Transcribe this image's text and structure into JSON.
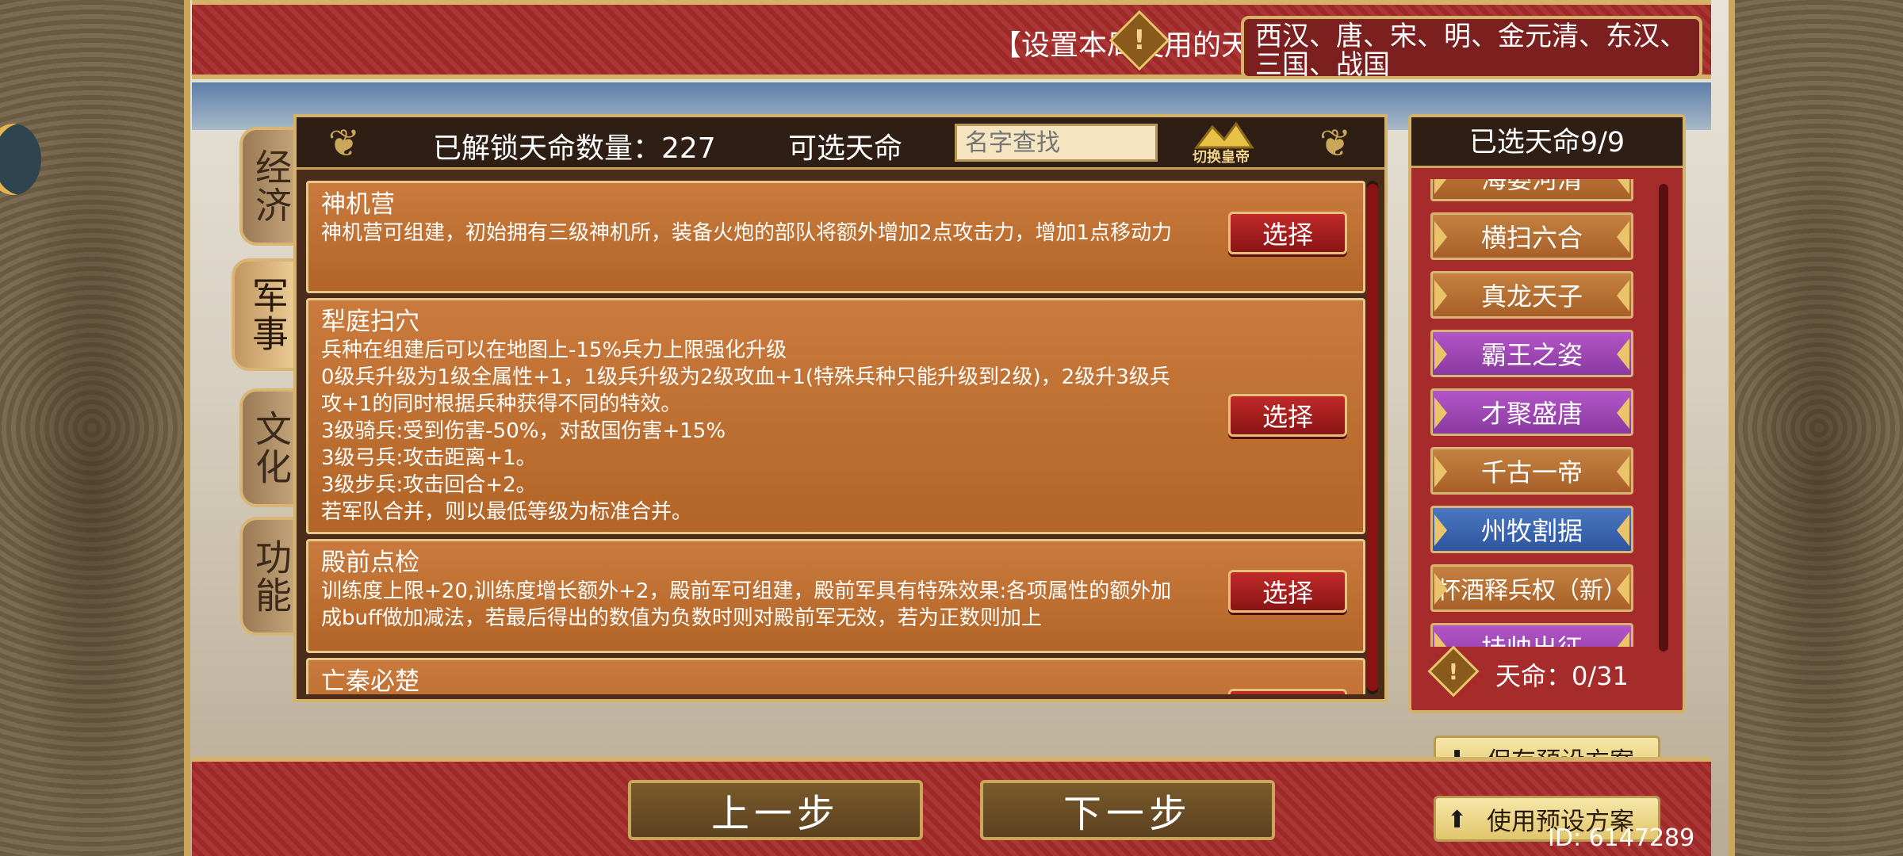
{
  "header": {
    "title": "【设置本局使用的天命】",
    "dynasties": "西汉、唐、宋、明、金元清、东汉、三国、战国"
  },
  "tabs": [
    {
      "label": "经济",
      "active": false
    },
    {
      "label": "军事",
      "active": true
    },
    {
      "label": "文化",
      "active": false
    },
    {
      "label": "功能",
      "active": false
    }
  ],
  "panel": {
    "unlocked": "已解锁天命数量：227",
    "available": "可选天命",
    "search_placeholder": "名字查找",
    "switch_label": "切换皇帝"
  },
  "cards": [
    {
      "title": "神机营",
      "desc": "神机营可组建，初始拥有三级神机所，装备火炮的部队将额外增加2点攻击力，增加1点移动力",
      "button": "选择"
    },
    {
      "title": "犁庭扫穴",
      "desc": "兵种在组建后可以在地图上-15%兵力上限强化升级\n0级兵升级为1级全属性+1，1级兵升级为2级攻血+1(特殊兵种只能升级到2级)，2级升3级兵攻+1的同时根据兵种获得不同的特效。\n3级骑兵:受到伤害-50%，对敌国伤害+15%\n3级弓兵:攻击距离+1。\n3级步兵:攻击回合+2。\n若军队合并，则以最低等级为标准合并。",
      "button": "选择"
    },
    {
      "title": "殿前点检",
      "desc": "训练度上限+20,训练度增长额外+2，殿前军可组建，殿前军具有特殊效果:各项属性的额外加成buff做加减法，若最后得出的数值为负数时则对殿前军无效，若为正数则加上",
      "button": "选择"
    },
    {
      "title": "亡秦必楚",
      "desc": "",
      "button": "选择"
    }
  ],
  "selected": {
    "header": "已选天命9/9",
    "items": [
      {
        "label": "海晏河清",
        "color": "orange"
      },
      {
        "label": "横扫六合",
        "color": "orange"
      },
      {
        "label": "真龙天子",
        "color": "orange"
      },
      {
        "label": "霸王之姿",
        "color": "purple"
      },
      {
        "label": "才聚盛唐",
        "color": "purple"
      },
      {
        "label": "千古一帝",
        "color": "orange"
      },
      {
        "label": "州牧割据",
        "color": "blue"
      },
      {
        "label": "杯酒释兵权（新）",
        "color": "orange"
      },
      {
        "label": "挂帅出征",
        "color": "purple"
      }
    ],
    "footer": "天命：0/31"
  },
  "presets": {
    "save": "保存预设方案",
    "use": "使用预设方案"
  },
  "nav": {
    "prev": "上一步",
    "next": "下一步"
  },
  "id_text": "ID: 6147289"
}
